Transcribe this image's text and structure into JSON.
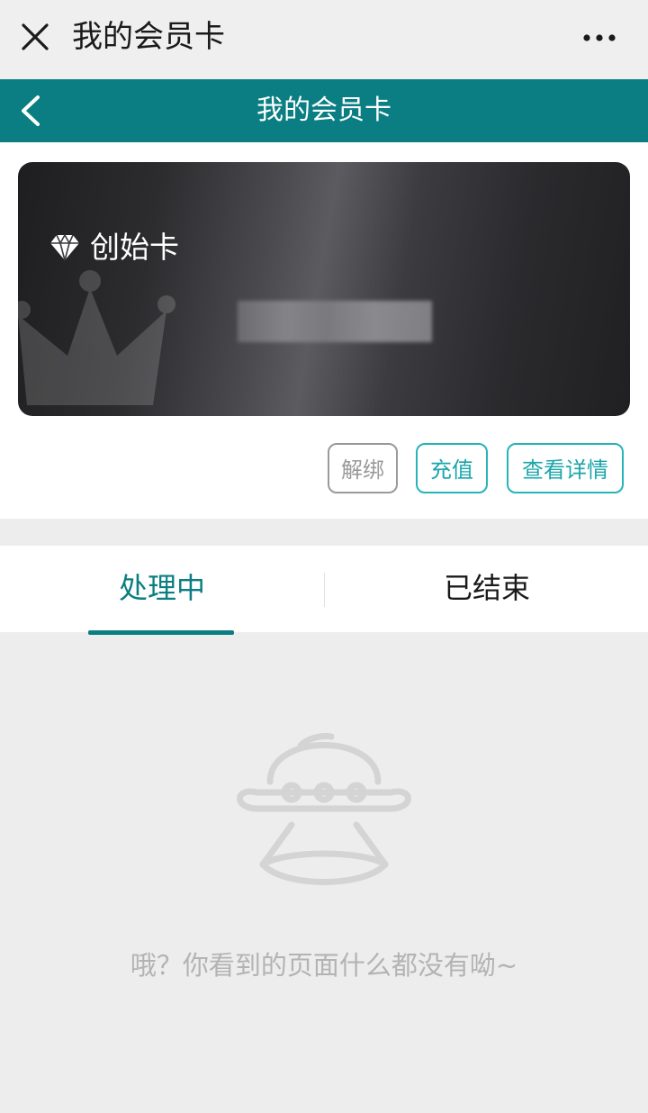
{
  "top_bar": {
    "title": "我的会员卡",
    "close_icon": "close-icon",
    "more_icon": "more-icon"
  },
  "nav_bar": {
    "title": "我的会员卡",
    "back_icon": "chevron-left-icon",
    "color": "#0a7e82"
  },
  "card": {
    "name": "创始卡",
    "icon": "diamond-icon"
  },
  "actions": {
    "unbind": "解绑",
    "recharge": "充值",
    "details": "查看详情"
  },
  "tabs": [
    {
      "label": "处理中",
      "active": true
    },
    {
      "label": "已结束",
      "active": false
    }
  ],
  "empty_state": {
    "icon": "ufo-icon",
    "message": "哦？你看到的页面什么都没有呦~"
  },
  "colors": {
    "accent": "#0a7e82",
    "button_accent": "#27b4b8"
  }
}
